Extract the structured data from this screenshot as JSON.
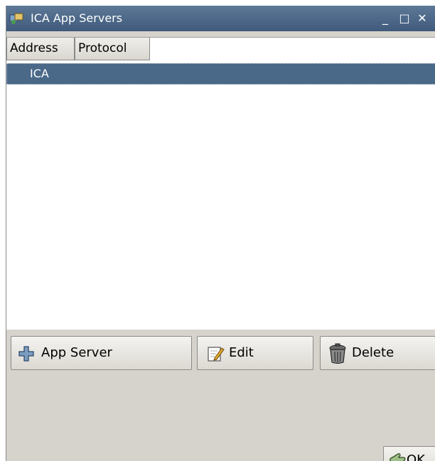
{
  "window": {
    "title": "ICA App Servers",
    "minimize_glyph": "_",
    "maximize_glyph": "□",
    "close_glyph": "✕"
  },
  "table": {
    "columns": [
      "Address",
      "Protocol"
    ],
    "rows": [
      {
        "address": "",
        "protocol": "ICA",
        "selected": true
      }
    ]
  },
  "buttons": {
    "add_label": "App Server",
    "edit_label": "Edit",
    "delete_label": "Delete",
    "ok_label": "OK"
  },
  "icons": {
    "title": "ica-app-icon",
    "add": "plus-icon",
    "edit": "edit-pencil-icon",
    "delete": "trash-can-icon",
    "ok": "ok-hand-icon"
  },
  "colors": {
    "titlebar": "#4a6686",
    "selection": "#4a6888",
    "window_bg": "#d6d3cc"
  }
}
